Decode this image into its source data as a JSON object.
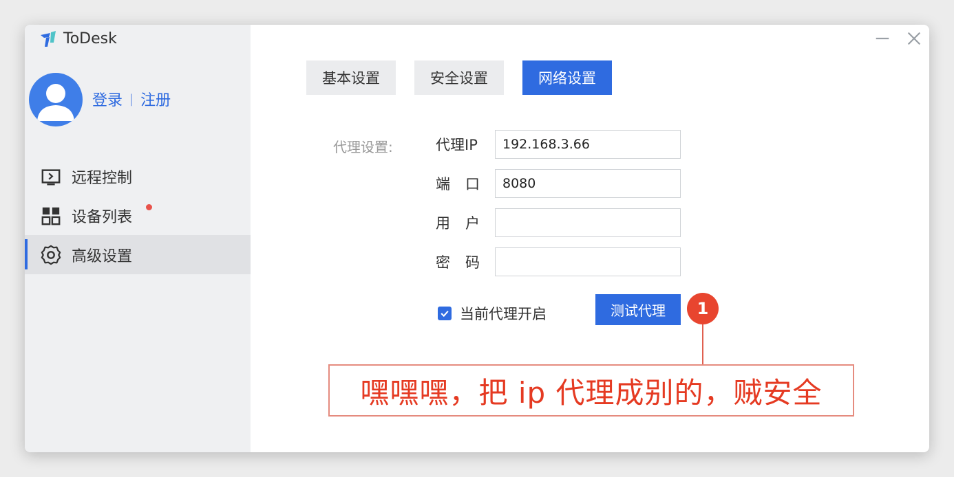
{
  "app": {
    "title": "ToDesk"
  },
  "auth": {
    "login": "登录",
    "separator": "|",
    "register": "注册"
  },
  "nav": {
    "items": [
      {
        "label": "远程控制",
        "icon": "remote-control-icon"
      },
      {
        "label": "设备列表",
        "icon": "device-grid-icon",
        "notification_dot": true
      },
      {
        "label": "高级设置",
        "icon": "gear-icon",
        "active": true
      }
    ]
  },
  "window_controls": {
    "minimize": "minimize-icon",
    "close": "close-icon"
  },
  "tabs": [
    {
      "label": "基本设置"
    },
    {
      "label": "安全设置"
    },
    {
      "label": "网络设置",
      "active": true
    }
  ],
  "proxy": {
    "section_label": "代理设置:",
    "fields": {
      "ip": {
        "label": "代理IP",
        "value": "192.168.3.66"
      },
      "port": {
        "label": "端口",
        "value": "8080"
      },
      "user": {
        "label": "用户",
        "value": ""
      },
      "password": {
        "label": "密码",
        "value": ""
      }
    },
    "enable_label": "当前代理开启",
    "enabled": true,
    "test_button": "测试代理"
  },
  "annotation": {
    "marker": "1",
    "text": "嘿嘿嘿，把 ip 代理成别的，贼安全"
  },
  "colors": {
    "accent": "#2f6be0",
    "annotation": "#e53a22",
    "sidebar_bg": "#eff0f2",
    "notification": "#e8524a"
  }
}
